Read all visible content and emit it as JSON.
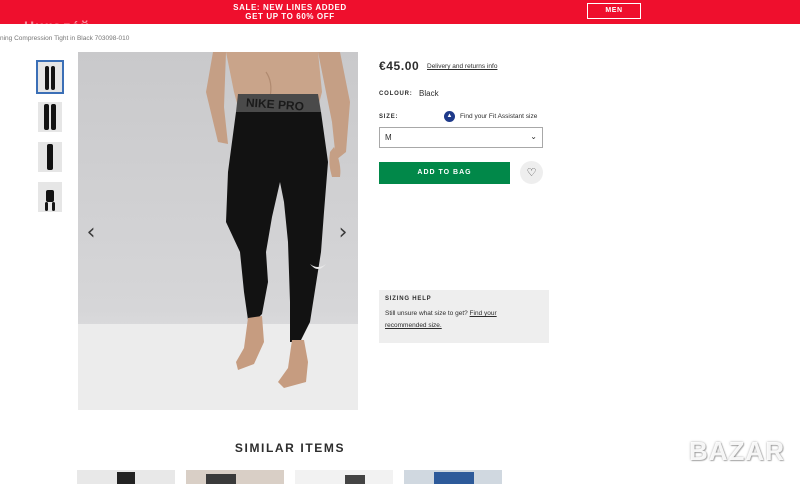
{
  "banner": {
    "line1": "SALE: NEW LINES ADDED",
    "line2": "GET UP TO 60% OFF",
    "button_label": "MEN",
    "color": "#ef0f2d"
  },
  "watermark_top": "Никола́й",
  "breadcrumb": "ning Compression Tight in Black 703098-010",
  "gallery": {
    "thumbnails": [
      "thumbnail-1",
      "thumbnail-2",
      "thumbnail-3",
      "thumbnail-4"
    ],
    "prev_icon": "‹",
    "next_icon": "›"
  },
  "product": {
    "price": "€45.00",
    "delivery_link": "Delivery and returns info",
    "colour_label": "COLOUR:",
    "colour_value": "Black",
    "size_label": "SIZE:",
    "fit_icon": "fit-assistant-icon",
    "fit_link": "Find your Fit Assistant size",
    "size_selected": "M",
    "add_to_bag": "ADD TO BAG",
    "add_color": "#018849",
    "save_icon": "♡"
  },
  "sizing_help": {
    "title": "SIZING HELP",
    "text": "Still unsure what size to get? ",
    "link_part1": "Find your",
    "link_part2": "recommended size."
  },
  "similar": {
    "title": "SIMILAR ITEMS"
  },
  "watermark_logo": "BAZAR"
}
